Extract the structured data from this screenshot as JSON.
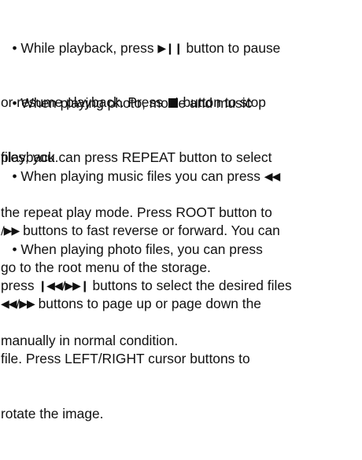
{
  "paragraphs": [
    {
      "lines": [
        {
          "pre": "   • While playback, press ",
          "sym": "▶❙❙",
          "post": " button to pause"
        },
        {
          "pre": "or resume playback. Press ",
          "stop": "■",
          "post": " button to stop"
        },
        {
          "pre": "playback."
        }
      ]
    },
    {
      "lines": [
        {
          "pre": "   • When playing photo, movie and music"
        },
        {
          "pre": "files, you can press REPEAT button to select"
        },
        {
          "pre": "the repeat play mode. Press ROOT button to"
        },
        {
          "pre": "go to the root menu of the storage."
        }
      ]
    },
    {
      "lines": [
        {
          "pre": "   • When playing music files you can press ",
          "sym": "◀◀"
        },
        {
          "pre": "",
          "sym": "/▶▶",
          "post": " buttons to fast reverse or forward. You can"
        },
        {
          "pre": "press ",
          "sym": "❙◀◀/▶▶❙",
          "post": " buttons to select the desired files"
        },
        {
          "pre": "manually in normal condition."
        }
      ]
    },
    {
      "lines": [
        {
          "pre": "   • When playing photo files, you can press"
        },
        {
          "pre": "",
          "sym": "◀◀/▶▶",
          "post": " buttons to page up or page down the"
        },
        {
          "pre": "file. Press LEFT/RIGHT cursor buttons to"
        },
        {
          "pre": "rotate the image."
        }
      ]
    }
  ]
}
